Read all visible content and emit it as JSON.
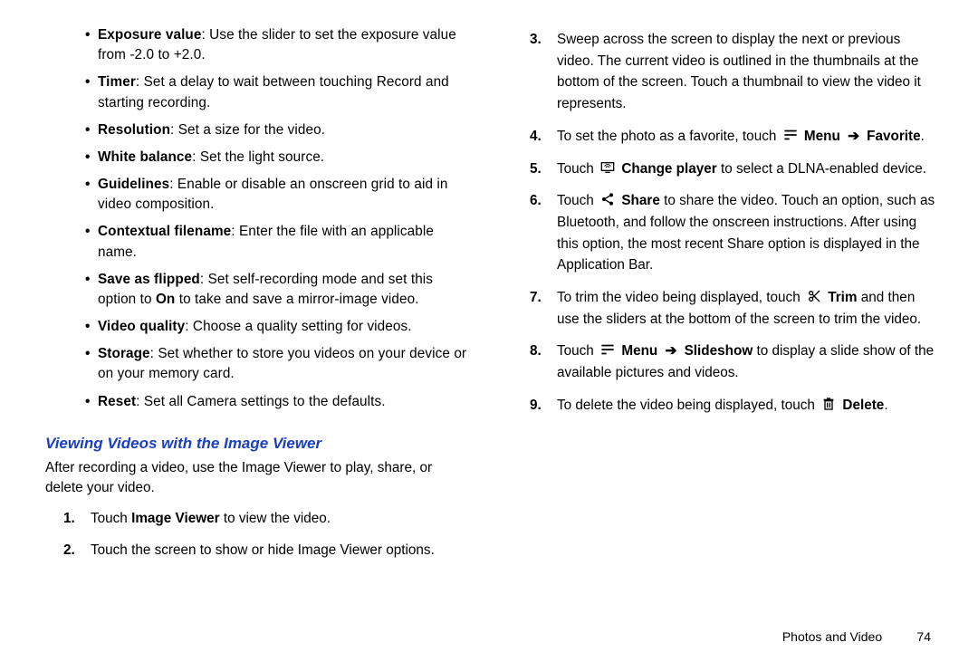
{
  "left": {
    "bullets": [
      {
        "term": "Exposure value",
        "desc": ": Use the slider to set the exposure value from -2.0 to +2.0."
      },
      {
        "term": "Timer",
        "desc": ": Set a delay to wait between touching Record and starting recording."
      },
      {
        "term": "Resolution",
        "desc": ": Set a size for the video."
      },
      {
        "term": "White balance",
        "desc": ": Set the light source."
      },
      {
        "term": "Guidelines",
        "desc": ": Enable or disable an onscreen grid to aid in video composition."
      },
      {
        "term": "Contextual filename",
        "desc": ": Enter the file with an applicable name."
      },
      {
        "term": "Save as flipped",
        "desc": ": Set self-recording mode and set this option to ",
        "extra_bold": "On",
        "desc2": " to take and save a mirror-image video."
      },
      {
        "term": "Video quality",
        "desc": ": Choose a quality setting for videos."
      },
      {
        "term": "Storage",
        "desc": ": Set whether to store you videos on your device or on your memory card."
      },
      {
        "term": "Reset",
        "desc": ": Set all Camera settings to the defaults."
      }
    ],
    "heading": "Viewing Videos with the Image Viewer",
    "intro": "After recording a video, use the Image Viewer to play, share, or delete your video.",
    "steps": [
      {
        "pre": "Touch ",
        "b": "Image Viewer",
        "post": " to view the video."
      },
      {
        "pre": "Touch the screen to show or hide Image Viewer options."
      }
    ]
  },
  "right": {
    "steps": [
      {
        "pre": "Sweep across the screen to display the next or previous video. The current video is outlined in the thumbnails at the bottom of the screen. Touch a thumbnail to view the video it represents."
      },
      {
        "pre": "To set the photo as a favorite, touch ",
        "icon": "menu",
        "b": "Menu",
        "arrow": true,
        "b2": "Favorite",
        "post": "."
      },
      {
        "pre": "Touch ",
        "icon": "changeplayer",
        "b": "Change player",
        "post": " to select a DLNA-enabled device."
      },
      {
        "pre": "Touch ",
        "icon": "share",
        "b": "Share",
        "post": " to share the video. Touch an option, such as Bluetooth, and follow the onscreen instructions. After using this option, the most recent Share option is displayed in the Application Bar."
      },
      {
        "pre": "To trim the video being displayed, touch ",
        "icon": "trim",
        "b": "Trim",
        "post": " and then use the sliders at the bottom of the screen to trim the video."
      },
      {
        "pre": "Touch ",
        "icon": "menu",
        "b": "Menu",
        "arrow": true,
        "b2": "Slideshow",
        "post": " to display a slide show of the available pictures and videos."
      },
      {
        "pre": "To delete the video being displayed, touch ",
        "icon": "delete",
        "b": "Delete",
        "post": "."
      }
    ]
  },
  "footer": {
    "section": "Photos and Video",
    "page": "74"
  }
}
